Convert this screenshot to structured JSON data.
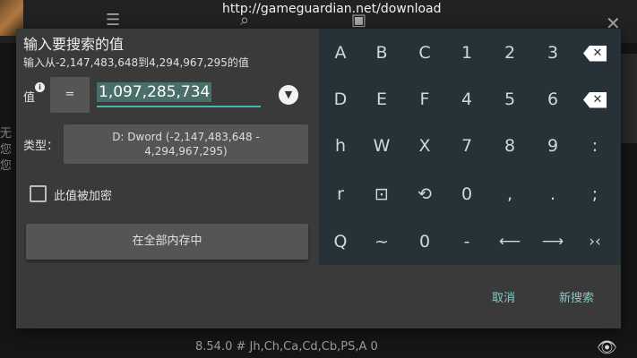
{
  "banner": {
    "url": "http://gameguardian.net/download"
  },
  "background": {
    "side_text": [
      "无",
      "您",
      "您"
    ],
    "version_line": "8.54.0 # Jh,Ch,Ca,Cd,Cb,PS,A 0",
    "icons": [
      "sliders-icon",
      "search-icon",
      "save-icon",
      "close-icon",
      "eye-icon"
    ]
  },
  "dialog": {
    "title": "输入要搜索的值",
    "range_hint": "输入从-2,147,483,648到4,294,967,295的值",
    "value_label": "值",
    "info_badge": "i",
    "operator": "=",
    "value": "1,097,285,734",
    "dropdown_icon": "▼",
    "type_label": "类型：",
    "type_value_line1": "D: Dword (-2,147,483,648 -",
    "type_value_line2": "4,294,967,295)",
    "encrypted_label": "此值被加密",
    "encrypted_checked": false,
    "region_button": "在全部内存中",
    "cancel": "取消",
    "new_search": "新搜索"
  },
  "keyboard": {
    "rows": [
      [
        "A",
        "B",
        "C",
        "1",
        "2",
        "3",
        "⌫"
      ],
      [
        "D",
        "E",
        "F",
        "4",
        "5",
        "6",
        "⌫"
      ],
      [
        "h",
        "W",
        "X",
        "7",
        "8",
        "9",
        ":"
      ],
      [
        "r",
        "⊡",
        "⟲",
        "0",
        ",",
        ".",
        ";"
      ],
      [
        "Q",
        "~",
        "0",
        "-",
        "⟵",
        "⟶",
        "›‹"
      ]
    ],
    "icons": [
      "backspace-icon",
      "selection-icon",
      "history-icon"
    ]
  },
  "colors": {
    "accent": "#4db6ac",
    "action_text": "#80cbc4",
    "keyboard_bg": "#263238",
    "dialog_bg": "#3a3a3a"
  }
}
